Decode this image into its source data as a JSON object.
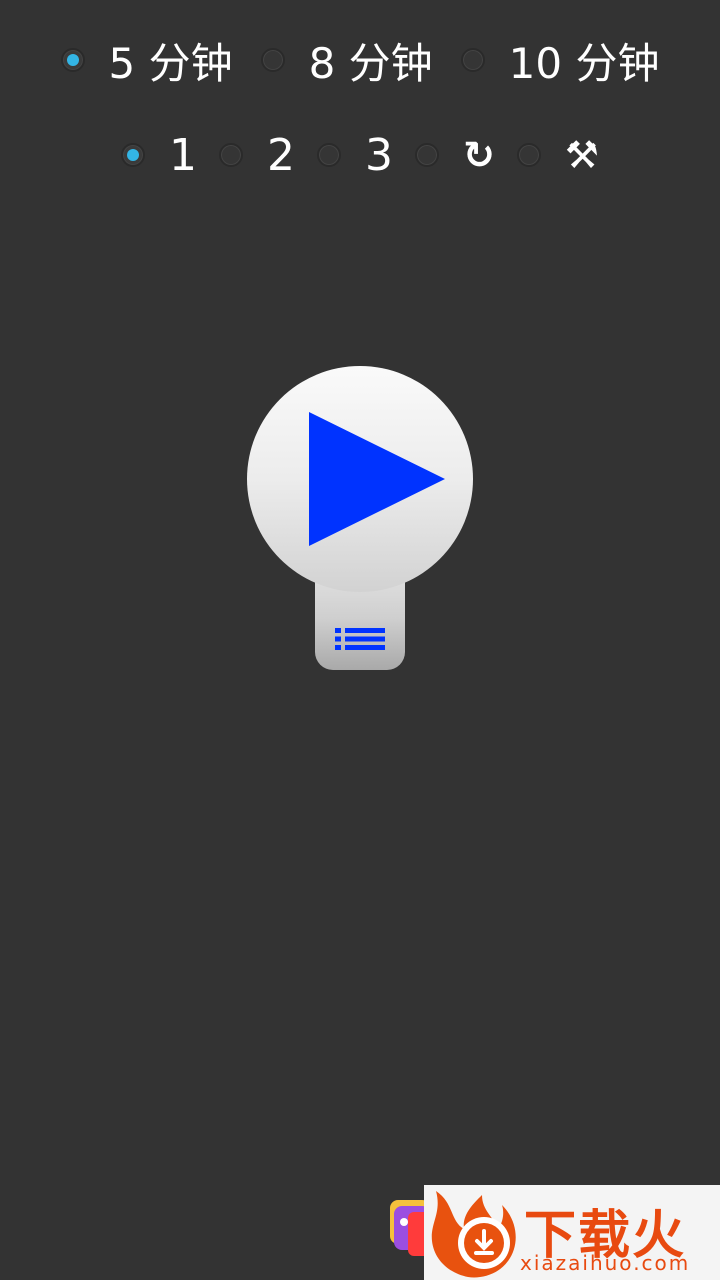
{
  "duration_options": [
    {
      "label": "5 分钟",
      "checked": true
    },
    {
      "label": "8 分钟",
      "checked": false
    },
    {
      "label": "10 分钟",
      "checked": false
    }
  ],
  "count_options": [
    {
      "label": "1",
      "checked": true
    },
    {
      "label": "2",
      "checked": false
    },
    {
      "label": "3",
      "checked": false
    },
    {
      "label": "↻",
      "checked": false,
      "icon": "repeat-icon"
    },
    {
      "label": "⚒",
      "checked": false,
      "icon": "hammer-pick-icon"
    }
  ],
  "play_button": {
    "icon": "play-icon",
    "color": "#0033ff"
  },
  "list_button": {
    "icon": "list-icon",
    "color": "#0033ff"
  },
  "colors": {
    "background": "#333333",
    "radio_accent": "#33b5e5",
    "text": "#ffffff",
    "watermark_brand": "#e84a10"
  },
  "watermark": {
    "title": "下载火",
    "subtitle": "xiazaihuo.com"
  }
}
